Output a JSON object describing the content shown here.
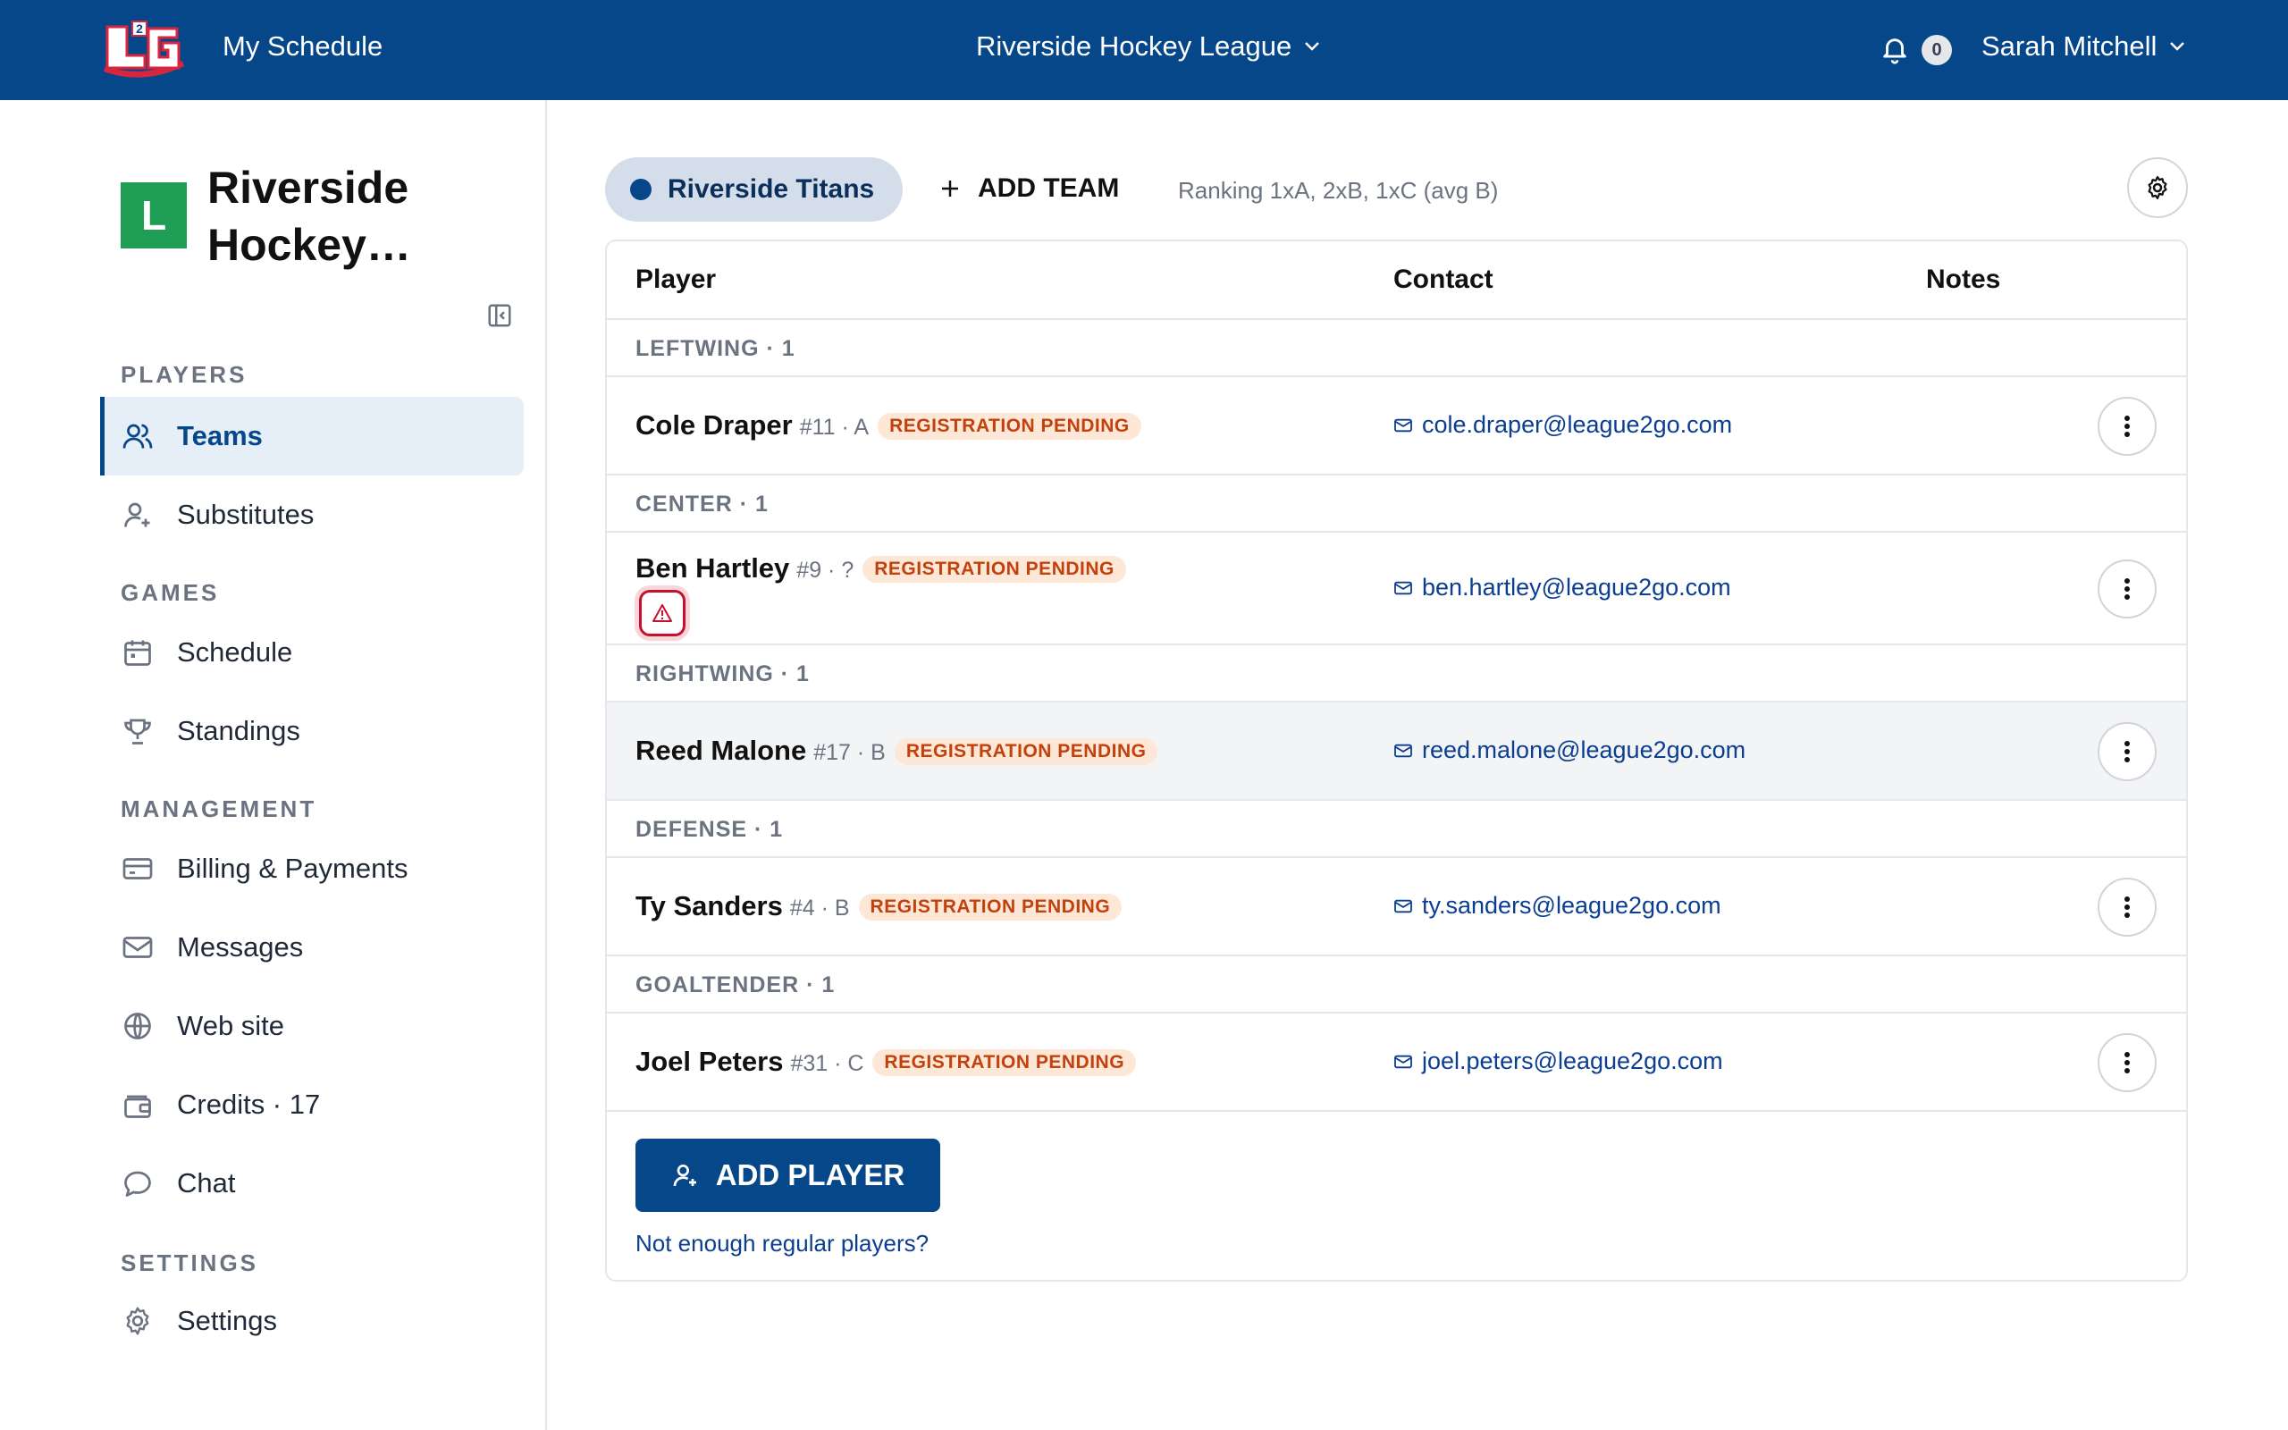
{
  "header": {
    "my_schedule": "My Schedule",
    "league_name": "Riverside Hockey League",
    "notification_count": "0",
    "user_name": "Sarah Mitchell"
  },
  "sidebar": {
    "org_badge": "L",
    "org_name": "Riverside Hockey…",
    "sections": {
      "players": "PLAYERS",
      "games": "GAMES",
      "management": "MANAGEMENT",
      "settings": "SETTINGS"
    },
    "items": {
      "teams": "Teams",
      "substitutes": "Substitutes",
      "schedule": "Schedule",
      "standings": "Standings",
      "billing": "Billing & Payments",
      "messages": "Messages",
      "website": "Web site",
      "credits": "Credits · 17",
      "chat": "Chat",
      "settings": "Settings"
    }
  },
  "team_bar": {
    "team_name": "Riverside Titans",
    "add_team": "ADD TEAM",
    "ranking": "Ranking 1xA, 2xB, 1xC (avg B)"
  },
  "table": {
    "headers": {
      "player": "Player",
      "contact": "Contact",
      "notes": "Notes"
    },
    "groups": [
      {
        "label": "LEFTWING · 1",
        "player": {
          "name": "Cole Draper",
          "meta": "#11 · A",
          "badge": "REGISTRATION PENDING",
          "email": "cole.draper@league2go.com"
        }
      },
      {
        "label": "CENTER · 1",
        "player": {
          "name": "Ben Hartley",
          "meta": "#9 · ?",
          "badge": "REGISTRATION PENDING",
          "email": "ben.hartley@league2go.com"
        }
      },
      {
        "label": "RIGHTWING · 1",
        "player": {
          "name": "Reed Malone",
          "meta": "#17 · B",
          "badge": "REGISTRATION PENDING",
          "email": "reed.malone@league2go.com"
        }
      },
      {
        "label": "DEFENSE · 1",
        "player": {
          "name": "Ty Sanders",
          "meta": "#4 · B",
          "badge": "REGISTRATION PENDING",
          "email": "ty.sanders@league2go.com"
        }
      },
      {
        "label": "GOALTENDER · 1",
        "player": {
          "name": "Joel Peters",
          "meta": "#31 · C",
          "badge": "REGISTRATION PENDING",
          "email": "joel.peters@league2go.com"
        }
      }
    ]
  },
  "actions": {
    "add_player": "ADD PLAYER",
    "not_enough": "Not enough regular players?"
  },
  "colors": {
    "brand": "#064789",
    "badge_bg": "#fde7d6",
    "badge_text": "#c2410c",
    "warning": "#c8102e",
    "org_badge": "#1f9d55"
  }
}
